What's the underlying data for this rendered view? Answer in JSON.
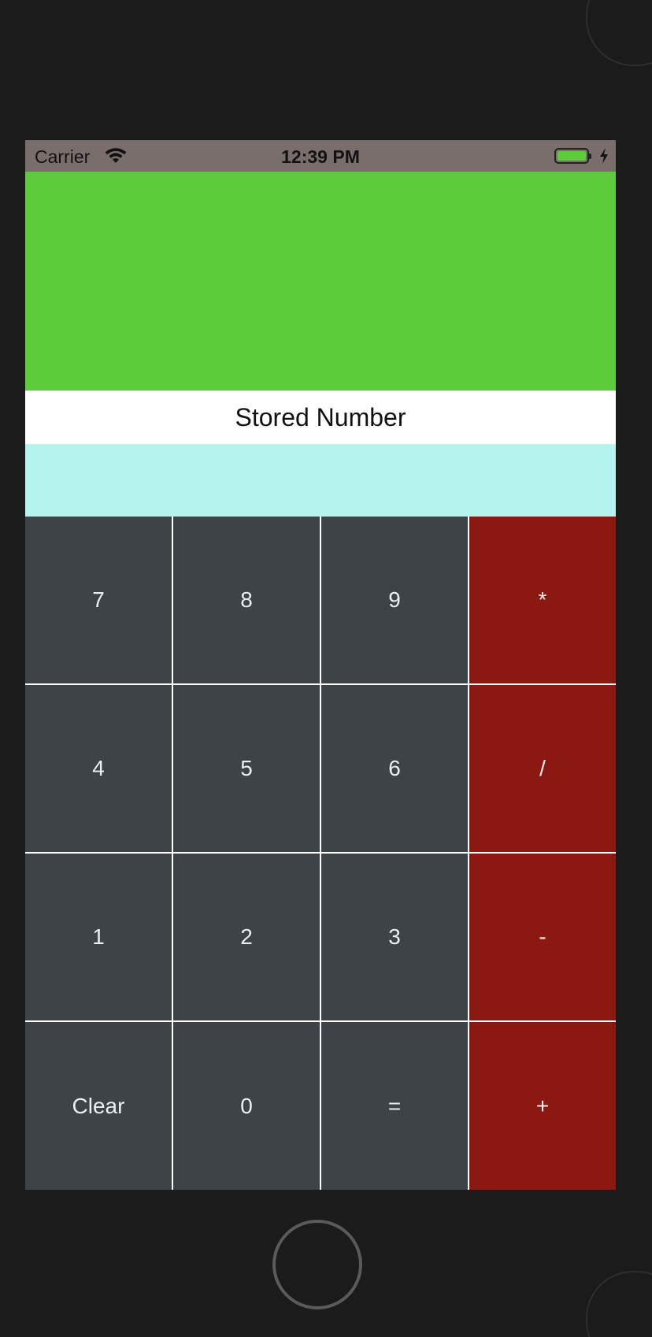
{
  "status_bar": {
    "carrier": "Carrier",
    "time": "12:39 PM",
    "wifi_icon": "wifi-icon",
    "battery_icon": "battery-icon",
    "charging_icon": "charging-bolt-icon"
  },
  "display": {
    "value": "",
    "color": "#5ccc3c"
  },
  "stored": {
    "label": "Stored Number",
    "value": "",
    "color": "#b6f4ef"
  },
  "keypad": {
    "rows": [
      [
        {
          "label": "7",
          "kind": "num"
        },
        {
          "label": "8",
          "kind": "num"
        },
        {
          "label": "9",
          "kind": "num"
        },
        {
          "label": "*",
          "kind": "op"
        }
      ],
      [
        {
          "label": "4",
          "kind": "num"
        },
        {
          "label": "5",
          "kind": "num"
        },
        {
          "label": "6",
          "kind": "num"
        },
        {
          "label": "/",
          "kind": "op"
        }
      ],
      [
        {
          "label": "1",
          "kind": "num"
        },
        {
          "label": "2",
          "kind": "num"
        },
        {
          "label": "3",
          "kind": "num"
        },
        {
          "label": "-",
          "kind": "op"
        }
      ],
      [
        {
          "label": "Clear",
          "kind": "num"
        },
        {
          "label": "0",
          "kind": "num"
        },
        {
          "label": "=",
          "kind": "num"
        },
        {
          "label": "+",
          "kind": "op"
        }
      ]
    ],
    "colors": {
      "number_key": "#3e4347",
      "operator_key": "#8c1911",
      "key_text": "#eceff1"
    }
  }
}
